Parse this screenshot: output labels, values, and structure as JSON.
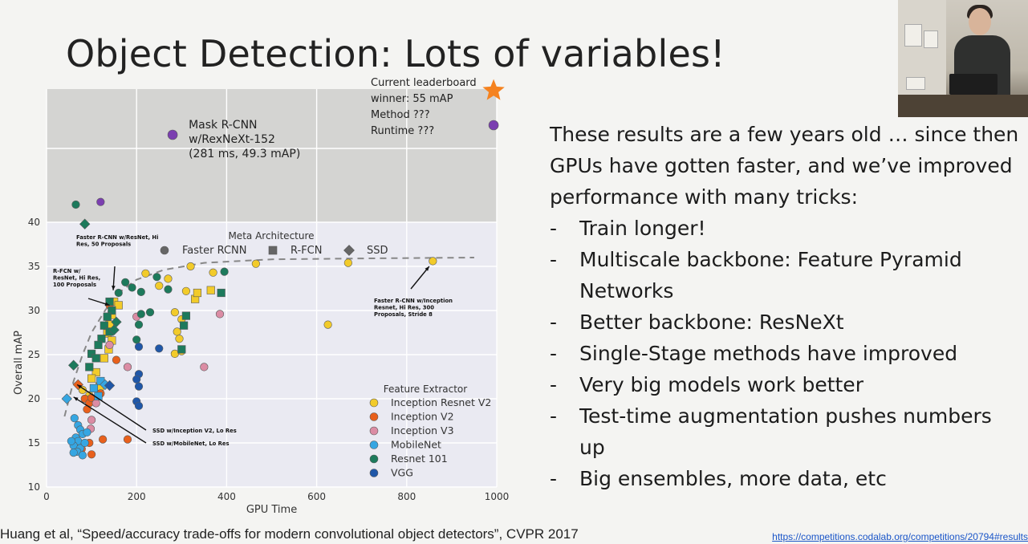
{
  "slide": {
    "title": "Object Detection: Lots of variables!",
    "bullets_intro": "These results are a few years old … since then GPUs have gotten faster, and we’ve improved performance with many tricks:",
    "bullets": [
      "Train longer!",
      "Multiscale backbone: Feature Pyramid Networks",
      "Better backbone: ResNeXt",
      "Single-Stage methods have improved",
      "Very big models work better",
      "Test-time augmentation pushes numbers up",
      "Big ensembles, more data, etc"
    ],
    "bullet_marker": "-",
    "citation": "Huang et al, “Speed/accuracy trade-offs for modern convolutional object detectors”, CVPR 2017",
    "link": "https://competitions.codalab.org/competitions/20794#results"
  },
  "chart_data": {
    "type": "scatter",
    "xlabel": "GPU Time",
    "ylabel": "Overall mAP",
    "xlim": [
      0,
      1000
    ],
    "ylim": [
      10,
      40
    ],
    "xticks": [
      0,
      200,
      400,
      600,
      800,
      1000
    ],
    "yticks": [
      10,
      15,
      20,
      25,
      30,
      35,
      40
    ],
    "grid": true,
    "colors": {
      "plot_bg": "#eaeaf2",
      "grid": "#ffffff",
      "overlay": "#d4d4d2",
      "Inception Resnet V2": "#f2cb2a",
      "Inception V2": "#e8601c",
      "Inception V3": "#db8ca4",
      "MobileNet": "#35a6e2",
      "Resnet 101": "#1d7a5c",
      "VGG": "#1f57a8",
      "purple": "#7b3fb0",
      "star": "#f5821f"
    },
    "meta_legend": {
      "title": "Meta Architecture",
      "items": [
        {
          "label": "Faster RCNN",
          "marker": "circle"
        },
        {
          "label": "R-FCN",
          "marker": "square"
        },
        {
          "label": "SSD",
          "marker": "diamond"
        }
      ]
    },
    "feature_legend": {
      "title": "Feature Extractor",
      "items": [
        "Inception Resnet V2",
        "Inception V2",
        "Inception V3",
        "MobileNet",
        "Resnet 101",
        "VGG"
      ]
    },
    "frontier": [
      [
        40,
        18
      ],
      [
        60,
        22
      ],
      [
        80,
        25
      ],
      [
        100,
        27.5
      ],
      [
        130,
        30
      ],
      [
        160,
        32
      ],
      [
        200,
        33.5
      ],
      [
        260,
        34.6
      ],
      [
        350,
        35.4
      ],
      [
        500,
        35.8
      ],
      [
        700,
        35.9
      ],
      [
        950,
        36
      ]
    ],
    "points": [
      {
        "x": 220,
        "y": 34.2,
        "c": "Inception Resnet V2",
        "m": "circle"
      },
      {
        "x": 250,
        "y": 32.8,
        "c": "Inception Resnet V2",
        "m": "circle"
      },
      {
        "x": 270,
        "y": 33.6,
        "c": "Inception Resnet V2",
        "m": "circle"
      },
      {
        "x": 320,
        "y": 35.0,
        "c": "Inception Resnet V2",
        "m": "circle"
      },
      {
        "x": 370,
        "y": 34.3,
        "c": "Inception Resnet V2",
        "m": "circle"
      },
      {
        "x": 465,
        "y": 35.3,
        "c": "Inception Resnet V2",
        "m": "circle"
      },
      {
        "x": 670,
        "y": 35.4,
        "c": "Inception Resnet V2",
        "m": "circle"
      },
      {
        "x": 858,
        "y": 35.6,
        "c": "Inception Resnet V2",
        "m": "circle"
      },
      {
        "x": 625,
        "y": 28.4,
        "c": "Inception Resnet V2",
        "m": "circle"
      },
      {
        "x": 310,
        "y": 32.2,
        "c": "Inception Resnet V2",
        "m": "circle"
      },
      {
        "x": 330,
        "y": 31.3,
        "c": "Inception Resnet V2",
        "m": "square"
      },
      {
        "x": 335,
        "y": 32.0,
        "c": "Inception Resnet V2",
        "m": "square"
      },
      {
        "x": 365,
        "y": 32.3,
        "c": "Inception Resnet V2",
        "m": "square"
      },
      {
        "x": 285,
        "y": 29.8,
        "c": "Inception Resnet V2",
        "m": "circle"
      },
      {
        "x": 300,
        "y": 29.0,
        "c": "Inception Resnet V2",
        "m": "circle"
      },
      {
        "x": 290,
        "y": 27.6,
        "c": "Inception Resnet V2",
        "m": "circle"
      },
      {
        "x": 295,
        "y": 26.8,
        "c": "Inception Resnet V2",
        "m": "circle"
      },
      {
        "x": 285,
        "y": 25.1,
        "c": "Inception Resnet V2",
        "m": "circle"
      },
      {
        "x": 300,
        "y": 25.4,
        "c": "Inception Resnet V2",
        "m": "circle"
      },
      {
        "x": 150,
        "y": 31.0,
        "c": "Inception Resnet V2",
        "m": "square"
      },
      {
        "x": 160,
        "y": 30.6,
        "c": "Inception Resnet V2",
        "m": "square"
      },
      {
        "x": 145,
        "y": 29.5,
        "c": "Inception Resnet V2",
        "m": "square"
      },
      {
        "x": 140,
        "y": 28.4,
        "c": "Inception Resnet V2",
        "m": "square"
      },
      {
        "x": 135,
        "y": 27.4,
        "c": "Inception Resnet V2",
        "m": "square"
      },
      {
        "x": 145,
        "y": 26.6,
        "c": "Inception Resnet V2",
        "m": "square"
      },
      {
        "x": 138,
        "y": 25.6,
        "c": "Inception Resnet V2",
        "m": "square"
      },
      {
        "x": 128,
        "y": 24.6,
        "c": "Inception Resnet V2",
        "m": "square"
      },
      {
        "x": 110,
        "y": 23.0,
        "c": "Inception Resnet V2",
        "m": "square"
      },
      {
        "x": 100,
        "y": 22.3,
        "c": "Inception Resnet V2",
        "m": "square"
      },
      {
        "x": 118,
        "y": 21.4,
        "c": "Inception Resnet V2",
        "m": "square"
      },
      {
        "x": 80,
        "y": 21.0,
        "c": "Inception Resnet V2",
        "m": "circle"
      },
      {
        "x": 95,
        "y": 20.4,
        "c": "Inception Resnet V2",
        "m": "circle"
      },
      {
        "x": 70,
        "y": 21.6,
        "c": "Inception V2",
        "m": "diamond"
      },
      {
        "x": 85,
        "y": 20.0,
        "c": "Inception V2",
        "m": "circle"
      },
      {
        "x": 95,
        "y": 19.5,
        "c": "Inception V2",
        "m": "circle"
      },
      {
        "x": 100,
        "y": 20.1,
        "c": "Inception V2",
        "m": "circle"
      },
      {
        "x": 90,
        "y": 18.8,
        "c": "Inception V2",
        "m": "circle"
      },
      {
        "x": 120,
        "y": 20.6,
        "c": "Inception V2",
        "m": "circle"
      },
      {
        "x": 125,
        "y": 15.4,
        "c": "Inception V2",
        "m": "circle"
      },
      {
        "x": 95,
        "y": 15.0,
        "c": "Inception V2",
        "m": "circle"
      },
      {
        "x": 100,
        "y": 13.7,
        "c": "Inception V2",
        "m": "circle"
      },
      {
        "x": 78,
        "y": 14.3,
        "c": "Inception V2",
        "m": "circle"
      },
      {
        "x": 180,
        "y": 15.4,
        "c": "Inception V2",
        "m": "circle"
      },
      {
        "x": 155,
        "y": 24.4,
        "c": "Inception V2",
        "m": "circle"
      },
      {
        "x": 140,
        "y": 30.6,
        "c": "Inception V2",
        "m": "circle"
      },
      {
        "x": 140,
        "y": 26.1,
        "c": "Inception V3",
        "m": "circle"
      },
      {
        "x": 180,
        "y": 23.6,
        "c": "Inception V3",
        "m": "circle"
      },
      {
        "x": 350,
        "y": 23.6,
        "c": "Inception V3",
        "m": "circle"
      },
      {
        "x": 385,
        "y": 29.6,
        "c": "Inception V3",
        "m": "circle"
      },
      {
        "x": 200,
        "y": 29.3,
        "c": "Inception V3",
        "m": "circle"
      },
      {
        "x": 100,
        "y": 17.6,
        "c": "Inception V3",
        "m": "circle"
      },
      {
        "x": 110,
        "y": 19.5,
        "c": "Inception V3",
        "m": "circle"
      },
      {
        "x": 98,
        "y": 16.6,
        "c": "Inception V3",
        "m": "circle"
      },
      {
        "x": 45,
        "y": 20.0,
        "c": "MobileNet",
        "m": "diamond"
      },
      {
        "x": 62,
        "y": 17.8,
        "c": "MobileNet",
        "m": "circle"
      },
      {
        "x": 70,
        "y": 17.0,
        "c": "MobileNet",
        "m": "circle"
      },
      {
        "x": 75,
        "y": 16.5,
        "c": "MobileNet",
        "m": "circle"
      },
      {
        "x": 80,
        "y": 16.0,
        "c": "MobileNet",
        "m": "circle"
      },
      {
        "x": 65,
        "y": 15.6,
        "c": "MobileNet",
        "m": "circle"
      },
      {
        "x": 70,
        "y": 15.2,
        "c": "MobileNet",
        "m": "circle"
      },
      {
        "x": 60,
        "y": 14.7,
        "c": "MobileNet",
        "m": "circle"
      },
      {
        "x": 75,
        "y": 14.4,
        "c": "MobileNet",
        "m": "circle"
      },
      {
        "x": 68,
        "y": 14.0,
        "c": "MobileNet",
        "m": "circle"
      },
      {
        "x": 80,
        "y": 13.6,
        "c": "MobileNet",
        "m": "circle"
      },
      {
        "x": 85,
        "y": 15.0,
        "c": "MobileNet",
        "m": "circle"
      },
      {
        "x": 90,
        "y": 16.2,
        "c": "MobileNet",
        "m": "circle"
      },
      {
        "x": 55,
        "y": 15.2,
        "c": "MobileNet",
        "m": "circle"
      },
      {
        "x": 60,
        "y": 13.9,
        "c": "MobileNet",
        "m": "circle"
      },
      {
        "x": 120,
        "y": 22.0,
        "c": "MobileNet",
        "m": "square"
      },
      {
        "x": 115,
        "y": 20.3,
        "c": "MobileNet",
        "m": "square"
      },
      {
        "x": 105,
        "y": 21.2,
        "c": "MobileNet",
        "m": "square"
      },
      {
        "x": 130,
        "y": 21.6,
        "c": "MobileNet",
        "m": "diamond"
      },
      {
        "x": 60,
        "y": 23.8,
        "c": "Resnet 101",
        "m": "diamond"
      },
      {
        "x": 85,
        "y": 39.8,
        "c": "Resnet 101",
        "m": "diamond"
      },
      {
        "x": 65,
        "y": 42.0,
        "c": "Resnet 101",
        "m": "circle"
      },
      {
        "x": 140,
        "y": 31.0,
        "c": "Resnet 101",
        "m": "square"
      },
      {
        "x": 145,
        "y": 30.0,
        "c": "Resnet 101",
        "m": "square"
      },
      {
        "x": 135,
        "y": 29.3,
        "c": "Resnet 101",
        "m": "square"
      },
      {
        "x": 128,
        "y": 28.3,
        "c": "Resnet 101",
        "m": "square"
      },
      {
        "x": 140,
        "y": 27.6,
        "c": "Resnet 101",
        "m": "square"
      },
      {
        "x": 122,
        "y": 26.8,
        "c": "Resnet 101",
        "m": "square"
      },
      {
        "x": 115,
        "y": 26.1,
        "c": "Resnet 101",
        "m": "square"
      },
      {
        "x": 100,
        "y": 25.1,
        "c": "Resnet 101",
        "m": "square"
      },
      {
        "x": 110,
        "y": 24.6,
        "c": "Resnet 101",
        "m": "square"
      },
      {
        "x": 95,
        "y": 23.6,
        "c": "Resnet 101",
        "m": "square"
      },
      {
        "x": 160,
        "y": 32.0,
        "c": "Resnet 101",
        "m": "circle"
      },
      {
        "x": 175,
        "y": 33.2,
        "c": "Resnet 101",
        "m": "circle"
      },
      {
        "x": 190,
        "y": 32.6,
        "c": "Resnet 101",
        "m": "circle"
      },
      {
        "x": 210,
        "y": 32.1,
        "c": "Resnet 101",
        "m": "circle"
      },
      {
        "x": 245,
        "y": 33.8,
        "c": "Resnet 101",
        "m": "circle"
      },
      {
        "x": 270,
        "y": 32.4,
        "c": "Resnet 101",
        "m": "circle"
      },
      {
        "x": 395,
        "y": 34.4,
        "c": "Resnet 101",
        "m": "circle"
      },
      {
        "x": 210,
        "y": 29.6,
        "c": "Resnet 101",
        "m": "circle"
      },
      {
        "x": 230,
        "y": 29.8,
        "c": "Resnet 101",
        "m": "circle"
      },
      {
        "x": 205,
        "y": 28.4,
        "c": "Resnet 101",
        "m": "circle"
      },
      {
        "x": 200,
        "y": 26.7,
        "c": "Resnet 101",
        "m": "circle"
      },
      {
        "x": 310,
        "y": 29.4,
        "c": "Resnet 101",
        "m": "square"
      },
      {
        "x": 305,
        "y": 28.3,
        "c": "Resnet 101",
        "m": "square"
      },
      {
        "x": 300,
        "y": 25.6,
        "c": "Resnet 101",
        "m": "square"
      },
      {
        "x": 388,
        "y": 32.0,
        "c": "Resnet 101",
        "m": "square"
      },
      {
        "x": 155,
        "y": 28.7,
        "c": "Resnet 101",
        "m": "diamond"
      },
      {
        "x": 150,
        "y": 27.8,
        "c": "Resnet 101",
        "m": "diamond"
      },
      {
        "x": 205,
        "y": 25.9,
        "c": "VGG",
        "m": "circle"
      },
      {
        "x": 250,
        "y": 25.7,
        "c": "VGG",
        "m": "circle"
      },
      {
        "x": 205,
        "y": 22.8,
        "c": "VGG",
        "m": "circle"
      },
      {
        "x": 200,
        "y": 22.2,
        "c": "VGG",
        "m": "circle"
      },
      {
        "x": 205,
        "y": 21.4,
        "c": "VGG",
        "m": "circle"
      },
      {
        "x": 200,
        "y": 19.7,
        "c": "VGG",
        "m": "circle"
      },
      {
        "x": 205,
        "y": 19.2,
        "c": "VGG",
        "m": "circle"
      },
      {
        "x": 140,
        "y": 21.5,
        "c": "VGG",
        "m": "diamond"
      },
      {
        "x": 120,
        "y": 42.3,
        "c": "purple",
        "m": "circle"
      }
    ],
    "overlay_points": [
      {
        "x": 280,
        "label": "Mask R-CNN\nw/RexNeXt-152\n(281 ms, 49.3 mAP)",
        "c": "purple",
        "m": "circle"
      },
      {
        "x": 993,
        "label": "",
        "c": "purple",
        "m": "circle"
      },
      {
        "x": 993,
        "label": "Current leaderboard\nwinner: 55 mAP\nMethod ???\nRuntime ???",
        "c": "star",
        "m": "star"
      }
    ],
    "annotations": [
      {
        "text": "Faster R-CNN w/ResNet, Hi\nRes, 50 Proposals",
        "target": [
          148,
          32.3
        ]
      },
      {
        "text": "R-FCN w/\nResNet, Hi Res,\n100 Proposals",
        "target": [
          140,
          30.6
        ]
      },
      {
        "text": "Faster R-CNN w/Inception\nResnet, Hi Res, 300\nProposals, Stride 8",
        "target": [
          850,
          35.0
        ]
      },
      {
        "text": "SSD w/Inception V2, Lo Res",
        "target": [
          68,
          21.6
        ]
      },
      {
        "text": "SSD w/MobileNet, Lo Res",
        "target": [
          60,
          20.2
        ]
      }
    ]
  }
}
